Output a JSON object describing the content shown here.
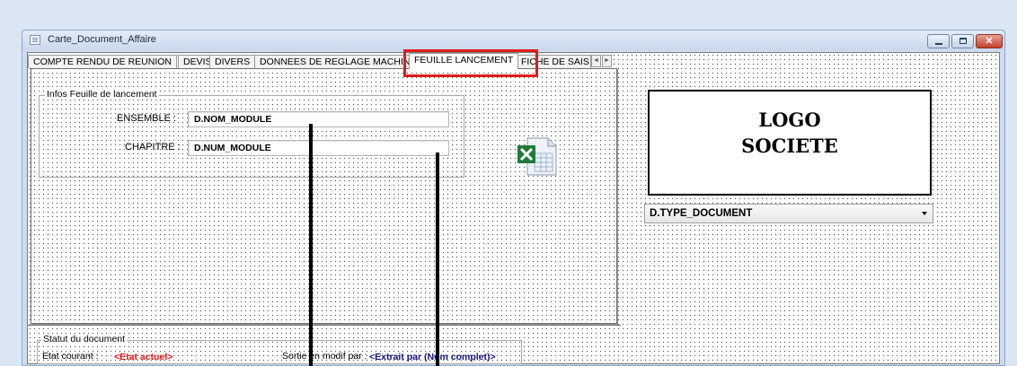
{
  "window": {
    "title": "Carte_Document_Affaire"
  },
  "tabs": [
    {
      "label": "COMPTE RENDU DE REUNION"
    },
    {
      "label": "DEVIS"
    },
    {
      "label": "DIVERS"
    },
    {
      "label": "DONNEES DE REGLAGE MACHINE"
    },
    {
      "label": "FEUILLE LANCEMENT"
    },
    {
      "label": "FICHE DE SAIS"
    }
  ],
  "tab_scroll": {
    "left": "◄",
    "right": "►"
  },
  "group_infos": {
    "legend": "Infos Feuille de lancement",
    "ensemble_label": "ENSEMBLE :",
    "ensemble_value": "D.NOM_MODULE",
    "chapitre_label": "CHAPITRE :",
    "chapitre_value": "D.NUM_MODULE"
  },
  "logo": {
    "line1": "LOGO",
    "line2": "SOCIETE"
  },
  "type_combo": {
    "value": "D.TYPE_DOCUMENT"
  },
  "status": {
    "legend": "Statut du document",
    "etat_label": "Etat courant :",
    "etat_value": "<Etat actuel>",
    "sortie_label": "Sortie en modif par :",
    "sortie_value": "<Extrait par (Nom complet)>"
  },
  "icons": {
    "excel": "excel-file-icon"
  },
  "colors": {
    "highlight": "#e21a1a",
    "status_red": "#e01a1a",
    "status_blue": "#13137a"
  }
}
